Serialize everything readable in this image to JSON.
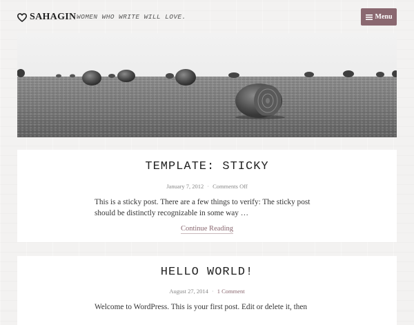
{
  "header": {
    "site_title": "SAHAGIN",
    "tagline": "WOMEN WHO WRITE WILL LOVE.",
    "menu_label": "Menu",
    "logo_icon": "heart-icon",
    "menu_icon": "hamburger-icon",
    "accent_color": "#8a6870"
  },
  "hero": {
    "subject": "hay bales in a field, black and white"
  },
  "posts": [
    {
      "title": "TEMPLATE: STICKY",
      "date": "January 7, 2012",
      "comments": "Comments Off",
      "excerpt": "This is a sticky post. There are a few things to verify: The sticky post should be distinctly recognizable in some way …",
      "continue_label": "Continue Reading"
    },
    {
      "title": "HELLO WORLD!",
      "date": "August 27, 2014",
      "comments": "1 Comment",
      "excerpt": "Welcome to WordPress. This is your first post. Edit or delete it, then"
    }
  ]
}
